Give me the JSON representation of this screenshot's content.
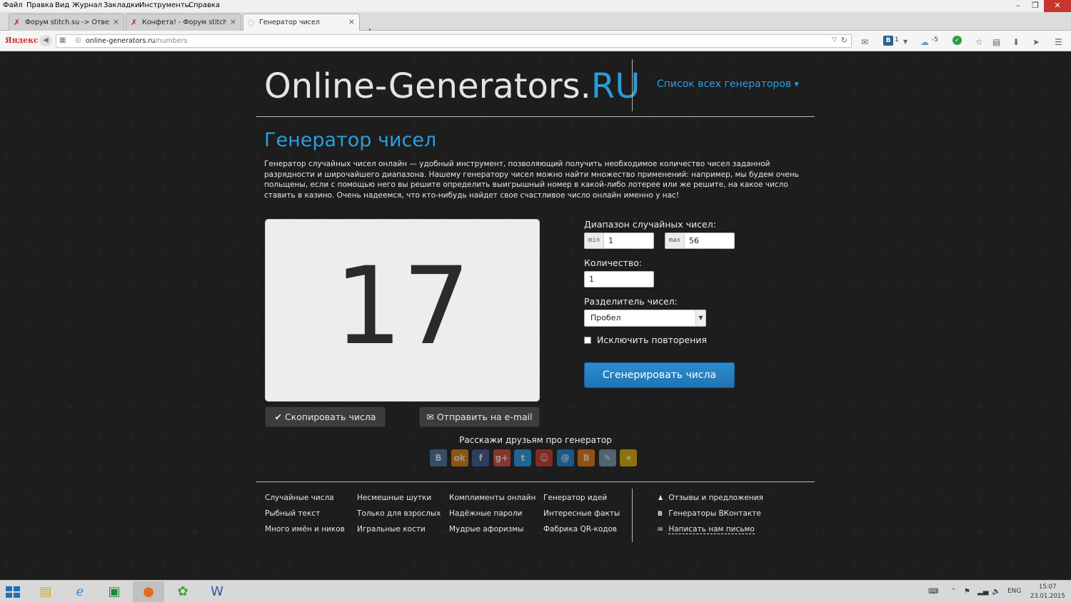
{
  "browser": {
    "menu": [
      "Файл",
      "Правка",
      "Вид",
      "Журнал",
      "Закладки",
      "Инструменты",
      "Справка"
    ],
    "tabs": [
      {
        "title": "Форум stitch.su -> Ответ ..."
      },
      {
        "title": "Конфета! - Форум stitch.su"
      },
      {
        "title": "Генератор чисел"
      }
    ],
    "new_tab_label": "+",
    "brand": "Яндекс",
    "url_host": "online-generators.ru",
    "url_path": "/numbers",
    "vk_count": "1",
    "weather_temp": "-5",
    "window_controls": {
      "minimize": "–",
      "restore": "❐",
      "close": "✕"
    }
  },
  "site": {
    "logo_main": "Online-Generators.",
    "logo_tld": "RU",
    "nav_link": "Список всех генераторов",
    "page_title": "Генератор чисел",
    "intro": "Генератор случайных чисел онлайн — удобный инструмент, позволяющий получить необходимое количество чисел заданной разрядности и широчайшего диапазона. Нашему генератору чисел можно найти множество применений: например, мы будем очень польщены, если с помощью него вы решите определить выигрышный номер в какой-либо лотерее или же решите, на какое число ставить в казино. Очень надеемся, что кто-нибудь найдет свое счастливое число онлайн именно у нас!"
  },
  "generator": {
    "result": "17",
    "copy_button": "Скопировать числа",
    "email_button": "Отправить на e-mail",
    "range_label": "Диапазон случайных чисел:",
    "min_prefix": "min",
    "min_value": "1",
    "max_prefix": "max",
    "max_value": "56",
    "count_label": "Количество:",
    "count_value": "1",
    "separator_label": "Разделитель чисел:",
    "separator_value": "Пробел",
    "no_repeat_label": "Исключить повторения",
    "no_repeat_checked": false,
    "generate_button": "Сгенерировать числа"
  },
  "share": {
    "title": "Расскажи друзьям про генератор",
    "icons": [
      {
        "name": "vkontakte-icon",
        "glyph": "B",
        "color": "#4c75a3"
      },
      {
        "name": "odnoklassniki-icon",
        "glyph": "ok",
        "color": "#ee8208"
      },
      {
        "name": "facebook-icon",
        "glyph": "f",
        "color": "#3b5998"
      },
      {
        "name": "google-plus-icon",
        "glyph": "g+",
        "color": "#dd4b39"
      },
      {
        "name": "twitter-icon",
        "glyph": "t",
        "color": "#1da1f2"
      },
      {
        "name": "moikrug-icon",
        "glyph": "☺",
        "color": "#d6362b"
      },
      {
        "name": "mailru-icon",
        "glyph": "@",
        "color": "#168de2"
      },
      {
        "name": "blogger-icon",
        "glyph": "B",
        "color": "#f57d00"
      },
      {
        "name": "livejournal-icon",
        "glyph": "✎",
        "color": "#7f9db9"
      },
      {
        "name": "bookmark-star-icon",
        "glyph": "★",
        "color": "#e6b800"
      }
    ]
  },
  "footer": {
    "col1": [
      "Случайные числа",
      "Рыбный текст",
      "Много имён и ников"
    ],
    "col2": [
      "Несмешные шутки",
      "Только для взрослых",
      "Игральные кости"
    ],
    "col3": [
      "Комплименты онлайн",
      "Надёжные пароли",
      "Мудрые афоризмы"
    ],
    "col4": [
      "Генератор идей",
      "Интересные факты",
      "Фабрика QR-кодов"
    ],
    "right": [
      {
        "icon": "user-icon",
        "glyph": "👤",
        "label": "Отзывы и предложения"
      },
      {
        "icon": "vk-icon",
        "glyph": "B",
        "label": "Генераторы ВКонтакте"
      },
      {
        "icon": "envelope-icon",
        "glyph": "✉",
        "label": "Написать нам письмо"
      }
    ]
  },
  "taskbar": {
    "lang": "ENG",
    "time": "15:07",
    "date": "23.01.2015"
  },
  "colors": {
    "accent": "#2a9ee0",
    "page_bg": "#1d1d1d",
    "button_blue": "#1f73b3"
  }
}
